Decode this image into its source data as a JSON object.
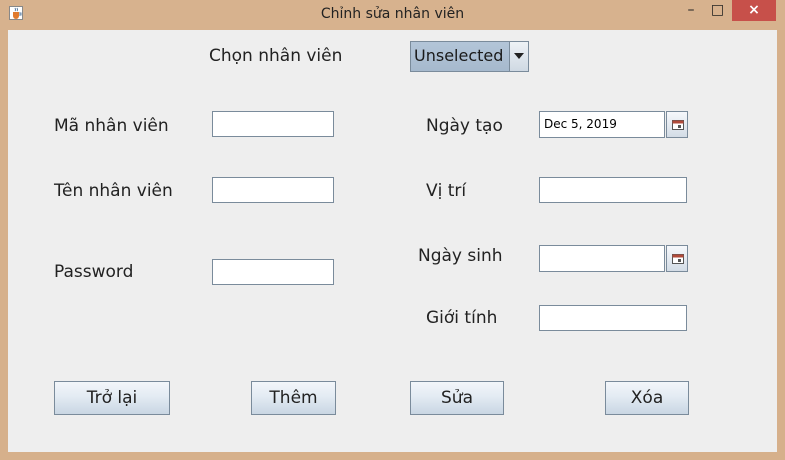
{
  "window": {
    "title": "Chỉnh sửa nhân viên",
    "minimize": "–",
    "maximize": "□",
    "close": "×"
  },
  "employee_select": {
    "label": "Chọn nhân viên",
    "selected": "Unselected"
  },
  "form": {
    "employee_id_label": "Mã nhân viên",
    "employee_id_value": "",
    "employee_name_label": "Tên nhân viên",
    "employee_name_value": "",
    "password_label": "Password",
    "password_value": "",
    "created_date_label": "Ngày tạo",
    "created_date_value": "Dec 5, 2019",
    "position_label": "Vị trí",
    "position_value": "",
    "birth_date_label": "Ngày sinh",
    "birth_date_value": "",
    "gender_label": "Giới tính",
    "gender_value": ""
  },
  "buttons": {
    "back": "Trở lại",
    "add": "Thêm",
    "edit": "Sửa",
    "delete": "Xóa"
  },
  "icons": {
    "app": "java-cup-icon",
    "calendar": "calendar-icon",
    "dropdown": "chevron-down-icon"
  },
  "colors": {
    "titlebar": "#d7b28e",
    "close_button": "#c7504a",
    "panel": "#eeeeee",
    "combo": "#a9bccf"
  }
}
